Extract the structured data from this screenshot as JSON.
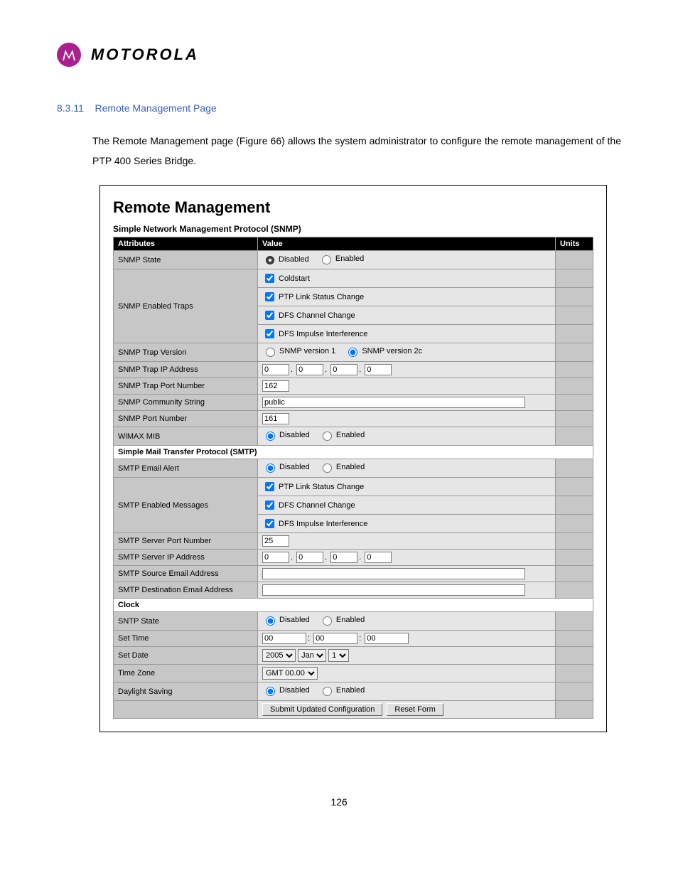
{
  "logo": {
    "word": "MOTOROLA"
  },
  "section": {
    "num": "8.3.11",
    "title": "Remote Management Page"
  },
  "intro": "The Remote Management page (Figure 66) allows the system administrator to configure the remote management of the PTP 400 Series Bridge.",
  "figure": {
    "title": "Remote Management",
    "snmp_sub": "Simple Network Management Protocol (SNMP)",
    "headers": {
      "attr": "Attributes",
      "val": "Value",
      "units": "Units"
    },
    "snmp": {
      "state_label": "SNMP State",
      "state_options": [
        "Disabled",
        "Enabled"
      ],
      "traps_label": "SNMP Enabled Traps",
      "traps": [
        "Coldstart",
        "PTP Link Status Change",
        "DFS Channel Change",
        "DFS Impulse Interference"
      ],
      "trap_ver_label": "SNMP Trap Version",
      "trap_ver_options": [
        "SNMP version 1",
        "SNMP version 2c"
      ],
      "trap_ip_label": "SNMP Trap IP Address",
      "trap_ip": [
        "0",
        "0",
        "0",
        "0"
      ],
      "trap_port_label": "SNMP Trap Port Number",
      "trap_port": "162",
      "community_label": "SNMP Community String",
      "community": "public",
      "port_label": "SNMP Port Number",
      "port": "161",
      "wimax_label": "WiMAX MIB",
      "wimax_options": [
        "Disabled",
        "Enabled"
      ]
    },
    "smtp_sub": "Simple Mail Transfer Protocol (SMTP)",
    "smtp": {
      "alert_label": "SMTP Email Alert",
      "alert_options": [
        "Disabled",
        "Enabled"
      ],
      "msgs_label": "SMTP Enabled Messages",
      "msgs": [
        "PTP Link Status Change",
        "DFS Channel Change",
        "DFS Impulse Interference"
      ],
      "srv_port_label": "SMTP Server Port Number",
      "srv_port": "25",
      "srv_ip_label": "SMTP Server IP Address",
      "srv_ip": [
        "0",
        "0",
        "0",
        "0"
      ],
      "src_email_label": "SMTP Source Email Address",
      "src_email": "",
      "dst_email_label": "SMTP Destination Email Address",
      "dst_email": ""
    },
    "clock_sub": "Clock",
    "clock": {
      "sntp_label": "SNTP State",
      "sntp_options": [
        "Disabled",
        "Enabled"
      ],
      "time_label": "Set Time",
      "time": [
        "00",
        "00",
        "00"
      ],
      "date_label": "Set Date",
      "date": {
        "year": "2005",
        "month": "Jan",
        "day": "1"
      },
      "tz_label": "Time Zone",
      "tz": "GMT 00.00",
      "dst_label": "Daylight Saving",
      "dst_options": [
        "Disabled",
        "Enabled"
      ]
    },
    "buttons": {
      "submit": "Submit Updated Configuration",
      "reset": "Reset Form"
    }
  },
  "page_number": "126"
}
